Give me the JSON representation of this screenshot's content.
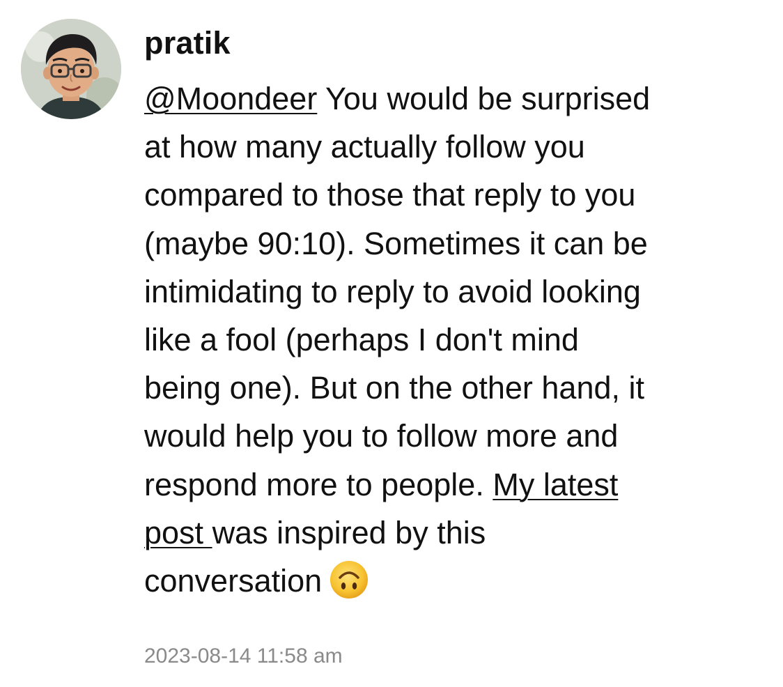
{
  "post": {
    "author": "pratik",
    "avatar_icon": "memoji-avatar",
    "lines": [
      {
        "mention": "@Moondeer",
        "text": " You would be surprised"
      },
      {
        "text": "at how many actually follow you"
      },
      {
        "text": "compared to those that reply to you"
      },
      {
        "text": "(maybe 90:10). Sometimes it can be"
      },
      {
        "text": "intimidating to reply to avoid looking"
      },
      {
        "text": "like a fool (perhaps I don't mind"
      },
      {
        "text": "being one). But on the other hand, it"
      },
      {
        "text": "would help you to follow more and"
      },
      {
        "text": "respond more to people. ",
        "link": "My latest"
      },
      {
        "link": "post ",
        "text": "was inspired by this"
      },
      {
        "text": "conversation",
        "emoji": "upside-down-face-emoji"
      }
    ],
    "timestamp": "2023-08-14 11:58 am"
  },
  "colors": {
    "text": "#111111",
    "timestamp": "#8a8a8a",
    "emoji": "#f7c331"
  }
}
